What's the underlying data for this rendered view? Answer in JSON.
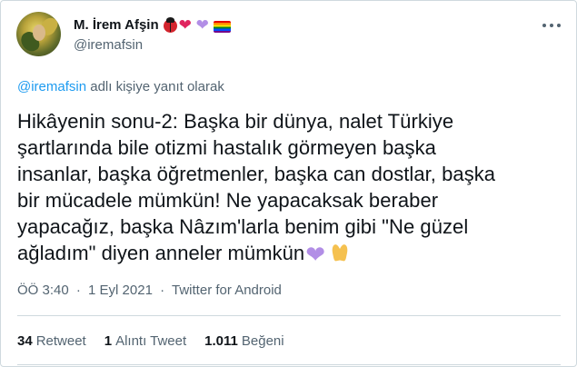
{
  "author": {
    "display_name": "M. İrem Afşin",
    "handle": "@iremafsin",
    "name_emojis": [
      "ladybug",
      "red-heart",
      "purple-heart",
      "rainbow-flag"
    ]
  },
  "reply": {
    "mention": "@iremafsin",
    "suffix": " adlı kişiye yanıt olarak"
  },
  "tweet": {
    "text": "Hikâyenin sonu-2: Başka bir dünya, nalet Türkiye\nşartlarında bile otizmi hastalık görmeyen başka\ninsanlar, başka öğretmenler, başka can dostlar, başka\nbir mücadele mümkün! Ne yapacaksak beraber\nyapacağız, başka Nâzım'larla benim gibi \"Ne güzel\nağladım\" diyen anneler mümkün",
    "end_emojis": [
      "purple-heart",
      "folded-hands"
    ]
  },
  "meta": {
    "time": "ÖÖ 3:40",
    "date": "1 Eyl 2021",
    "source": "Twitter for Android",
    "separator": "·"
  },
  "stats": {
    "retweets_count": "34",
    "retweets_label": "Retweet",
    "quotes_count": "1",
    "quotes_label": "Alıntı Tweet",
    "likes_count": "1.011",
    "likes_label": "Beğeni"
  },
  "colors": {
    "text": "#0f1419",
    "secondary": "#536471",
    "link": "#1d9bf0",
    "border": "#cfd9de",
    "purple_heart": "#b28ee6",
    "red_heart": "#e0245e"
  }
}
